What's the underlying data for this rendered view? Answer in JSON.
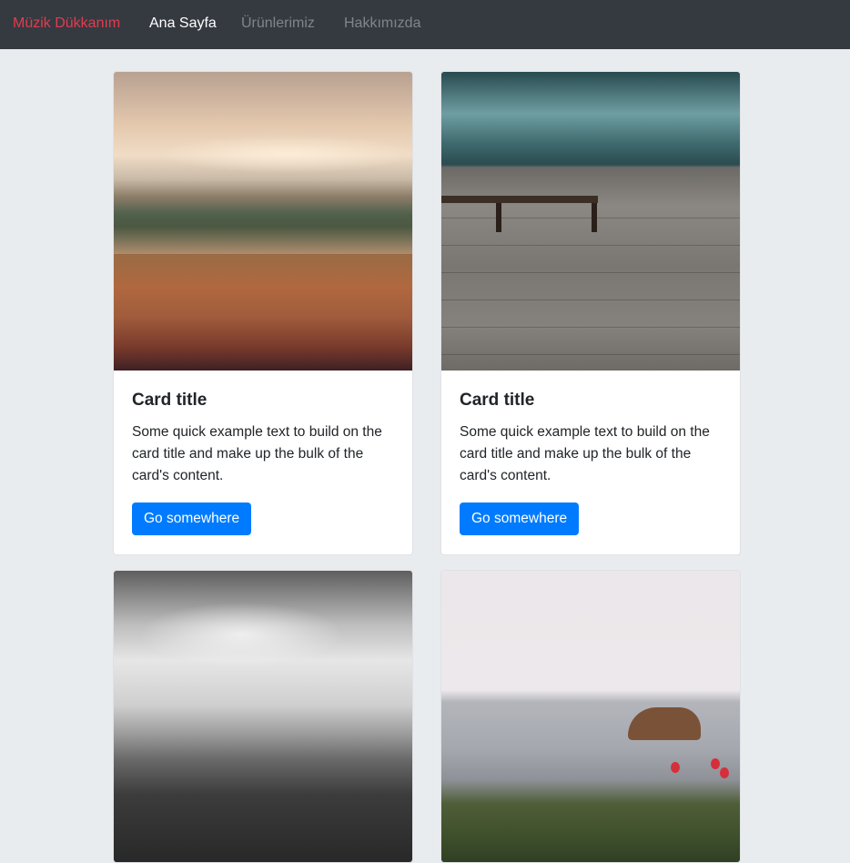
{
  "navbar": {
    "brand": "Müzik Dükkanım",
    "links": [
      "Ana Sayfa",
      "Ürünlerimiz",
      "Hakkımızda"
    ]
  },
  "cards": [
    {
      "title": "Card title",
      "text": "Some quick example text to build on the card title and make up the bulk of the card's content.",
      "button": "Go somewhere"
    },
    {
      "title": "Card title",
      "text": "Some quick example text to build on the card title and make up the bulk of the card's content.",
      "button": "Go somewhere"
    }
  ],
  "colors": {
    "navbar_bg": "#343a40",
    "brand": "#e53a4f",
    "page_bg": "#e9ecef",
    "button": "#007bff"
  }
}
